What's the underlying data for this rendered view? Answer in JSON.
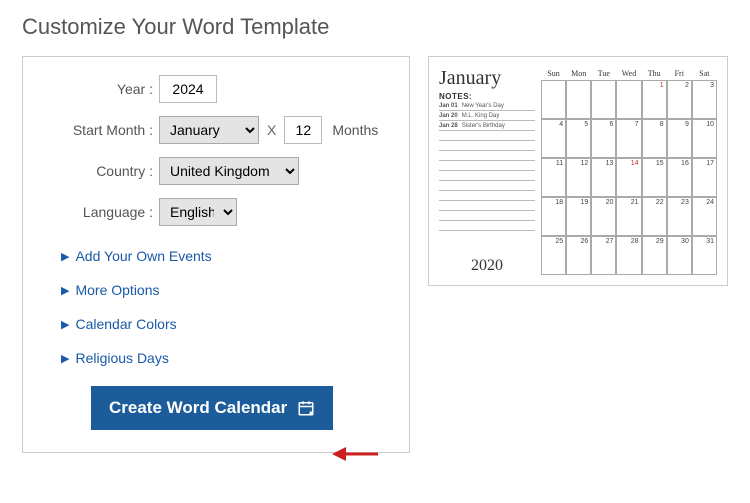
{
  "title": "Customize Your Word Template",
  "form": {
    "year_label": "Year :",
    "year_value": "2024",
    "start_month_label": "Start Month :",
    "start_month_value": "January",
    "x_sep": "X",
    "months_value": "12",
    "months_label": "Months",
    "country_label": "Country :",
    "country_value": "United Kingdom",
    "language_label": "Language :",
    "language_value": "English"
  },
  "links": {
    "events": "Add Your Own Events",
    "more": "More Options",
    "colors": "Calendar Colors",
    "religious": "Religious Days"
  },
  "button": {
    "label": "Create Word Calendar"
  },
  "preview": {
    "month": "January",
    "notes_label": "NOTES:",
    "notes": [
      {
        "date": "Jan 01",
        "text": "New Year's Day"
      },
      {
        "date": "Jan 20",
        "text": "M.L. King Day"
      },
      {
        "date": "Jan 28",
        "text": "Sister's Birthday"
      }
    ],
    "year": "2020",
    "weekdays": [
      "Sun",
      "Mon",
      "Tue",
      "Wed",
      "Thu",
      "Fri",
      "Sat"
    ],
    "cells": [
      "",
      "",
      "",
      "",
      "1",
      "2",
      "3",
      "4",
      "5",
      "6",
      "7",
      "8",
      "9",
      "10",
      "11",
      "12",
      "13",
      "14",
      "15",
      "16",
      "17",
      "18",
      "19",
      "20",
      "21",
      "22",
      "23",
      "24",
      "25",
      "26",
      "27",
      "28",
      "29",
      "30",
      "31"
    ],
    "red_indices": [
      4,
      17
    ]
  }
}
